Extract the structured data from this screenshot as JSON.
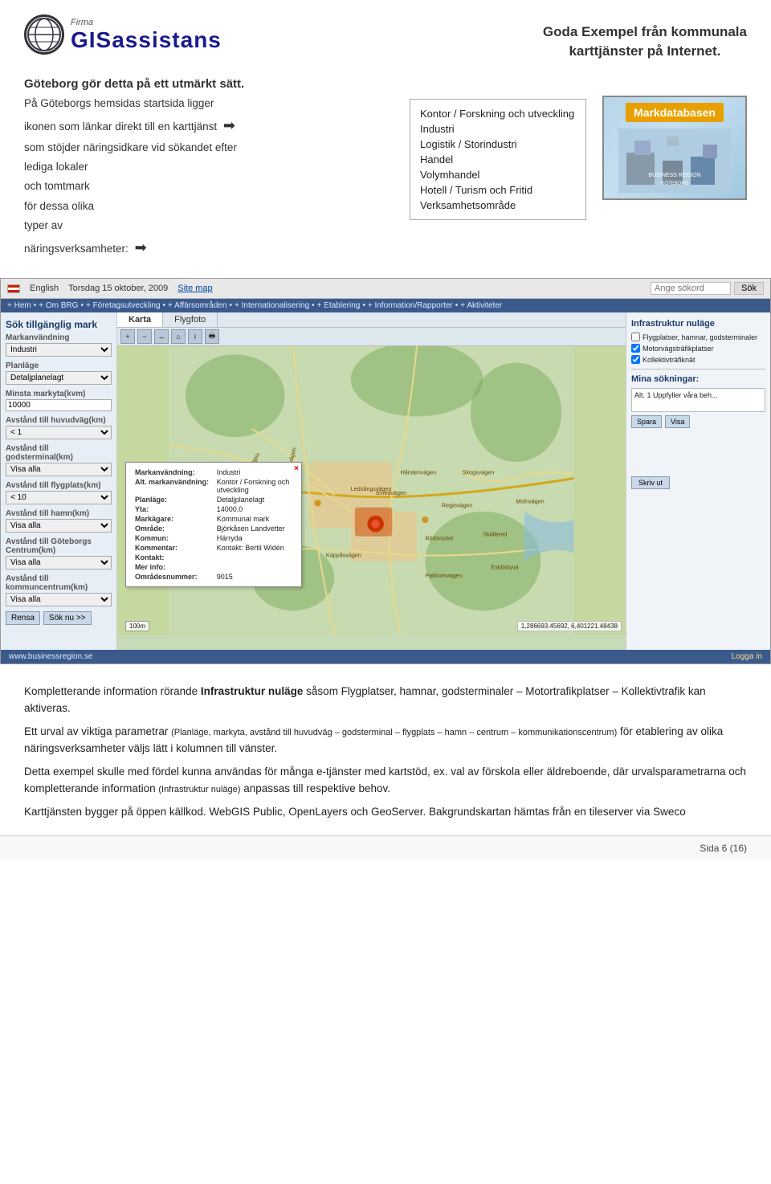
{
  "header": {
    "logo_firma": "Firma",
    "logo_name": "GISassistans",
    "title_line1": "Goda Exempel från kommunala",
    "title_line2": "karttjänster på Internet."
  },
  "intro": {
    "heading": "Göteborg gör detta på ett utmärkt sätt.",
    "body1": "På Göteborgs hemsidas startsida ligger",
    "body2": "ikonen  som länkar direkt till en karttjänst",
    "body3": "som stöjder näringsidkare vid sökandet efter",
    "body4": "lediga lokaler",
    "body5": "och tomtmark",
    "body6": "för dessa olika",
    "body7": "typer av",
    "body8": "näringsverksamheter:",
    "menu_items": [
      "Kontor / Forskning och utveckling",
      "Industri",
      "Logistik / Storindustri",
      "Handel",
      "Volymhandel",
      "Hotell / Turism och Fritid",
      "Verksamhetsområde"
    ],
    "markdata_label": "Markdatabasen"
  },
  "interface": {
    "topbar": {
      "language": "English",
      "date": "Torsdag 15 oktober, 2009",
      "sitemap": "Site map",
      "search_placeholder": "Ange sökord",
      "search_btn": "Sök"
    },
    "navbar": {
      "items": [
        "Hem",
        "Om BRG",
        "Företagsutveckling",
        "Affärsområden",
        "Internationalisering",
        "Etablering",
        "Information/Rapporter",
        "Aktiviteter"
      ]
    },
    "sidebar": {
      "title": "Sök tillgänglig mark",
      "fields": [
        {
          "label": "Markanvändning",
          "type": "select",
          "value": "Industri"
        },
        {
          "label": "Planläge",
          "type": "select",
          "value": "Detaljplanelagt"
        },
        {
          "label": "Minsta markyta(kvm)",
          "type": "text",
          "value": "10000"
        },
        {
          "label": "Avstånd till huvudväg(km)",
          "type": "select",
          "value": "< 1"
        },
        {
          "label": "Avstånd till godsterminal(km)",
          "type": "select",
          "value": "Visa alla"
        },
        {
          "label": "Avstånd till flygplats(km)",
          "type": "select",
          "value": "< 10"
        },
        {
          "label": "Avstånd till hamn(km)",
          "type": "select",
          "value": "Visa alla"
        },
        {
          "label": "Avstånd till Göteborgs Centrum(km)",
          "type": "select",
          "value": "Visa alla"
        },
        {
          "label": "Avstånd till kommuncentrum(km)",
          "type": "select",
          "value": "Visa alla"
        }
      ],
      "btn_rensa": "Rensa",
      "btn_sok": "Sök nu >>"
    },
    "map_tabs": [
      "Karta",
      "Flygfoto"
    ],
    "map_popup": {
      "close": "×",
      "rows": [
        {
          "label": "Markanvändning:",
          "value": "Industri"
        },
        {
          "label": "Alt. markanvändning:",
          "value": "Kontor / Forskning och\nutveckling"
        },
        {
          "label": "Planläge:",
          "value": "Detaljplanelagt"
        },
        {
          "label": "Yta:",
          "value": "14000.0"
        },
        {
          "label": "Markägare:",
          "value": "Kommunal mark"
        },
        {
          "label": "Område:",
          "value": "Björkåsen Landvetter"
        },
        {
          "label": "Kommun:",
          "value": "Härryda"
        },
        {
          "label": "Kommentar:",
          "value": "Kontakt: Bertil Widén"
        },
        {
          "label": "Kontakt:",
          "value": ""
        },
        {
          "label": "Mer info:",
          "value": ""
        },
        {
          "label": "Områdesnummer:",
          "value": "9015"
        }
      ]
    },
    "map_scale": "100m",
    "map_coords": "1,286693.45692, 6,401221.48438",
    "right_panel": {
      "title": "Infrastruktur nuläge",
      "checkboxes": [
        {
          "label": "Flygplatser, hamnar, godsterminaler",
          "checked": false
        },
        {
          "label": "Motorvägsträfikplatser",
          "checked": true
        },
        {
          "label": "Kollektivtráfiknät",
          "checked": true
        }
      ],
      "searches_title": "Mina sökningar:",
      "search_result": "Alt. 1 Uppfyller våra beh...",
      "btn_spara": "Spara",
      "btn_visa": "Visa",
      "btn_skriv": "Skriv ut"
    },
    "bottombar": {
      "url": "www.businessregion.se",
      "login": "Logga in"
    }
  },
  "text_paragraphs": [
    {
      "id": "p1",
      "text": "Kompletterande information rörande ",
      "bold": "Infrastruktur nuläge",
      "text2": " såsom Flygplatser, hamnar, godsterminaler – Motortrafikplatser – Kollektivtrafik kan aktiveras."
    },
    {
      "id": "p2",
      "text": "Ett urval av viktiga parametrar ",
      "small": "(Planläge, markyta, avstånd till huvudväg – godsterminal – flygplats – hamn – centrum – kommunikationscentrum)",
      "text2": " för etablering av olika näringsverksamheter väljs lätt i kolumnen till vänster."
    },
    {
      "id": "p3",
      "text": "Detta exempel skulle med fördel kunna användas för många e-tjänster med kartstöd, ex. val av förskola eller äldreboende, där urvalsparametrarna och kompletterande information ",
      "small2": "(Infrastruktur nuläge)",
      "text2": " anpassas till respektive behov."
    },
    {
      "id": "p4",
      "text": "Karttjänsten bygger på öppen källkod. WebGIS Public, OpenLayers och GeoServer. Bakgrundskartan hämtas från en tileserver via Sweco"
    }
  ],
  "footer": {
    "page_text": "Sida 6 (16)"
  }
}
